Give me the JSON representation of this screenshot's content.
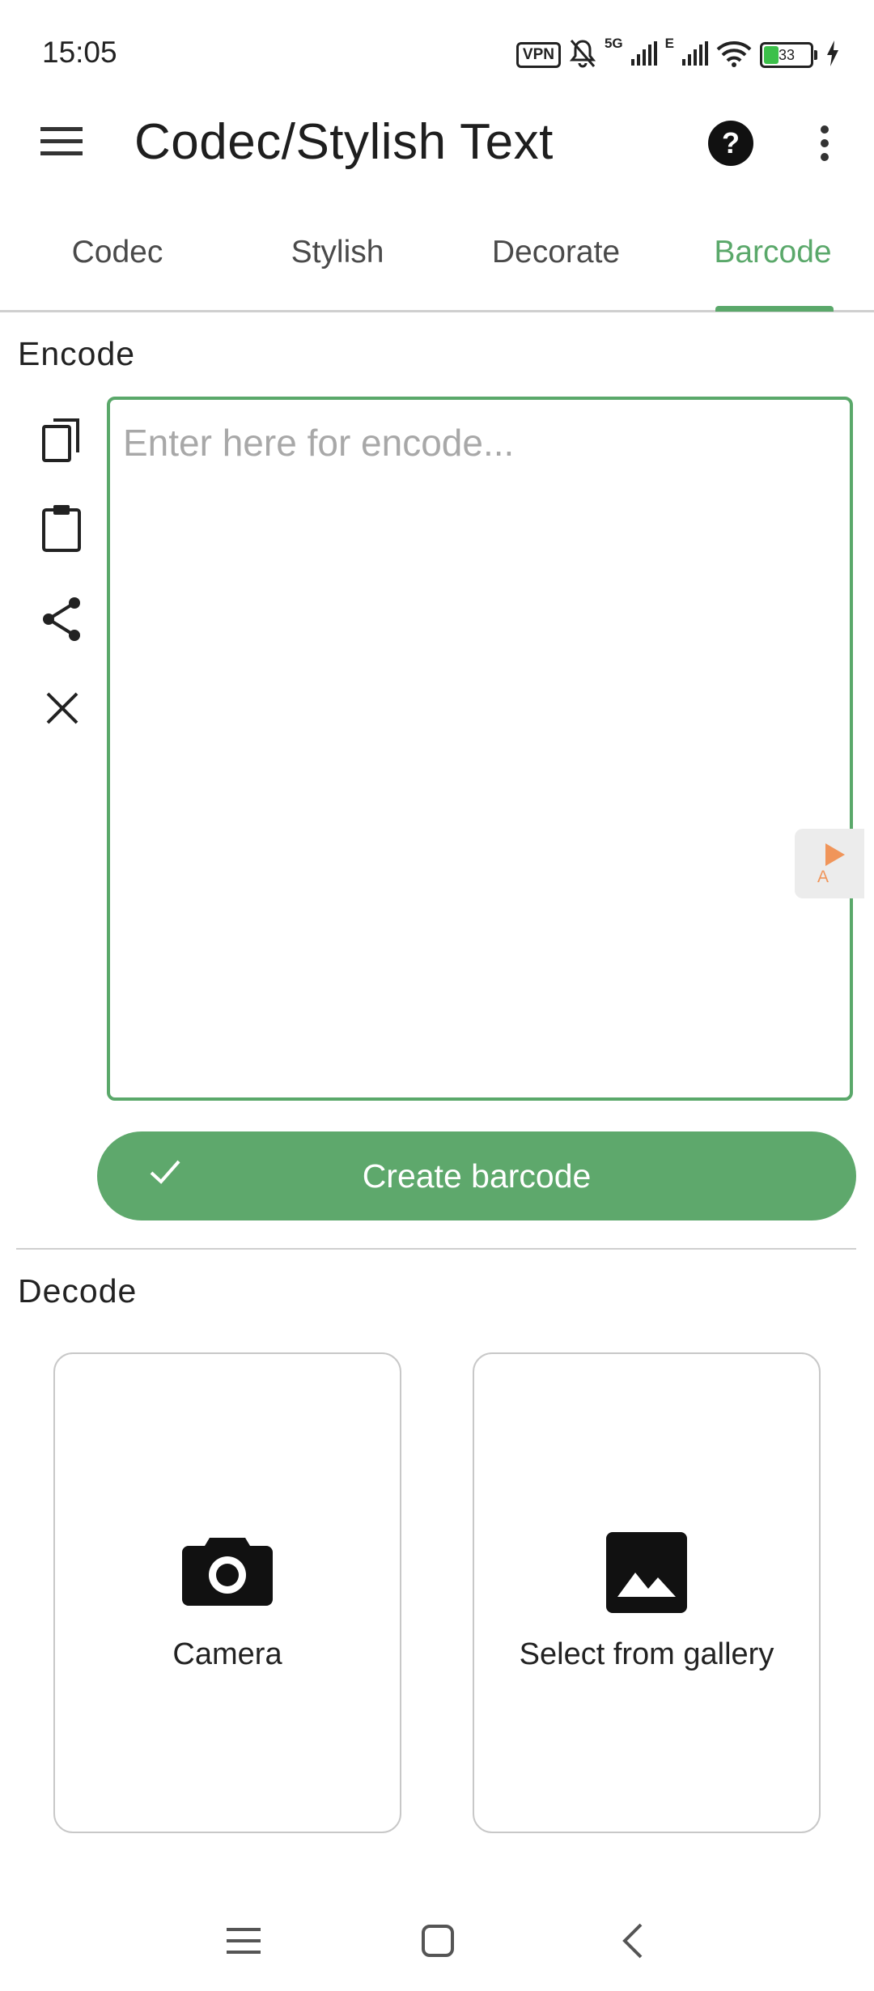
{
  "status_bar": {
    "time": "15:05",
    "vpn": "VPN",
    "net_5g": "5G",
    "net_e": "E",
    "battery_level": 33,
    "battery_text": "33"
  },
  "app_bar": {
    "title": "Codec/Stylish Text",
    "icons": [
      "hamburger-menu-icon",
      "help-icon",
      "more-vert-icon"
    ]
  },
  "tabs": [
    {
      "label": "Codec",
      "active": false
    },
    {
      "label": "Stylish",
      "active": false
    },
    {
      "label": "Decorate",
      "active": false
    },
    {
      "label": "Barcode",
      "active": true
    }
  ],
  "encode": {
    "section_label": "Encode",
    "placeholder": "Enter here for encode...",
    "value": "",
    "actions": [
      "copy-icon",
      "paste-icon",
      "share-icon",
      "clear-icon"
    ],
    "create_button_label": "Create barcode",
    "side_tab_label": "A"
  },
  "decode": {
    "section_label": "Decode",
    "options": [
      {
        "label": "Camera",
        "icon": "camera-icon"
      },
      {
        "label": "Select from gallery",
        "icon": "image-icon"
      }
    ]
  },
  "nav_bar": [
    "recents-icon",
    "home-icon",
    "back-icon"
  ],
  "colors": {
    "accent": "#5aa86a",
    "button": "#5ea86c",
    "side_tab_arrow": "#f0955a"
  }
}
